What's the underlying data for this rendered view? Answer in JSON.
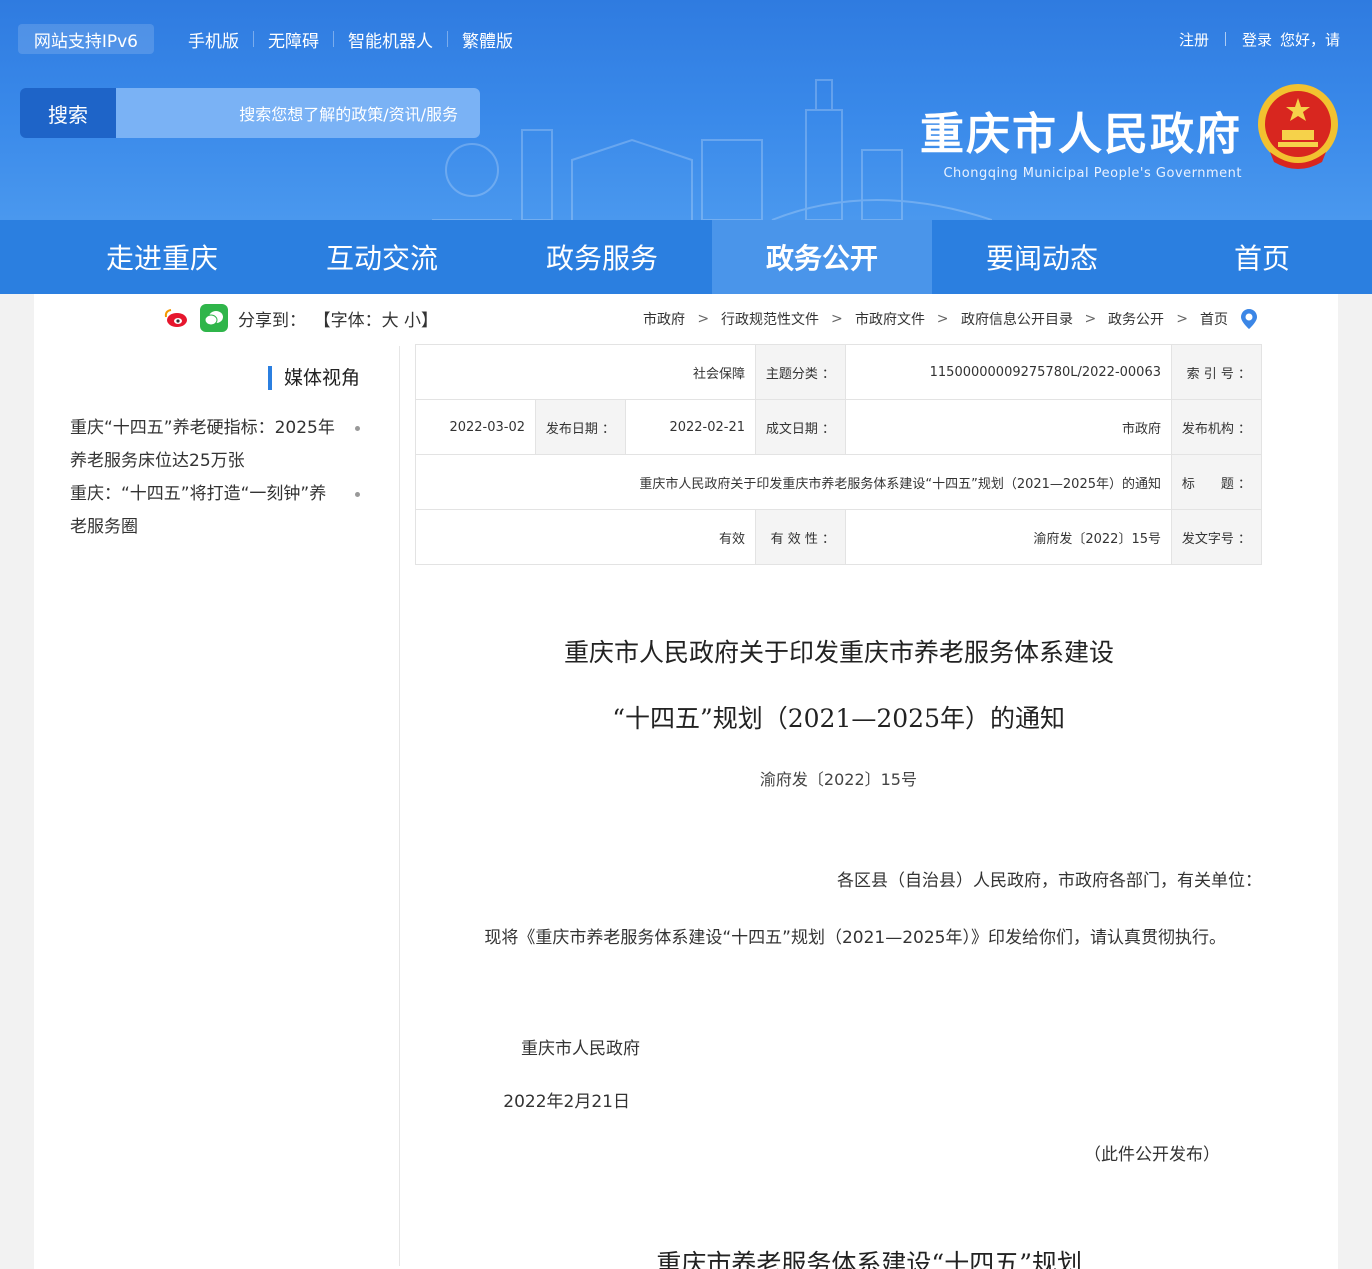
{
  "header": {
    "links_left": [
      "您好，请",
      "登录",
      "注册"
    ],
    "links_right": [
      "繁體版",
      "智能机器人",
      "无障碍",
      "手机版",
      "网站支持IPv6"
    ],
    "brand_cn": "重庆市人民政府",
    "brand_en": "Chongqing Municipal People's Government",
    "search_placeholder": "搜索您想了解的政策/资讯/服务",
    "search_button": "搜索"
  },
  "nav": {
    "tabs": [
      "首页",
      "要闻动态",
      "政务公开",
      "政务服务",
      "互动交流",
      "走进重庆"
    ],
    "active_index": 2
  },
  "breadcrumb": [
    "首页",
    "政务公开",
    "政府信息公开目录",
    "市政府文件",
    "行政规范性文件",
    "市政府"
  ],
  "font_control": "【字体：大 小】",
  "share_label": "分享到：",
  "meta": {
    "index_no_label": "索 引 号 ：",
    "index_no": "11500000009275780L/2022-00063",
    "topic_label": "主题分类 ：",
    "topic": "社会保障",
    "issuer_label": "发布机构 ：",
    "issuer": "市政府",
    "doc_date_label": "成文日期 ：",
    "doc_date": "2022-02-21",
    "pub_date_label": "发布日期 ：",
    "pub_date": "2022-03-02",
    "title_label": "标　　题 ：",
    "title": "重庆市人民政府关于印发重庆市养老服务体系建设“十四五”规划（2021—2025年）的通知",
    "doc_no_label": "发文字号 ：",
    "doc_no": "渝府发〔2022〕15号",
    "validity_label": "有 效 性 ：",
    "validity": "有效"
  },
  "sidebar": {
    "title": "媒体视角",
    "items": [
      "重庆“十四五”养老硬指标：2025年养老服务床位达25万张",
      "重庆：“十四五”将打造“一刻钟”养老服务圈"
    ]
  },
  "article": {
    "title_line1": "重庆市人民政府关于印发重庆市养老服务体系建设",
    "title_line2": "“十四五”规划（2021—2025年）的通知",
    "doc_no": "渝府发〔2022〕15号",
    "salutation": "各区县（自治县）人民政府，市政府各部门，有关单位：",
    "body": "现将《重庆市养老服务体系建设“十四五”规划（2021—2025年）》印发给你们，请认真贯彻执行。",
    "signer": "重庆市人民政府",
    "date": "2022年2月21日",
    "note": "（此件公开发布）",
    "subtitle": "重庆市养老服务体系建设“十四五”规划"
  },
  "colors": {
    "header_blue": "#2f7be0",
    "nav_blue": "#2b7fe0",
    "nav_active": "#4a95ea",
    "search_button": "#1e64c8"
  }
}
